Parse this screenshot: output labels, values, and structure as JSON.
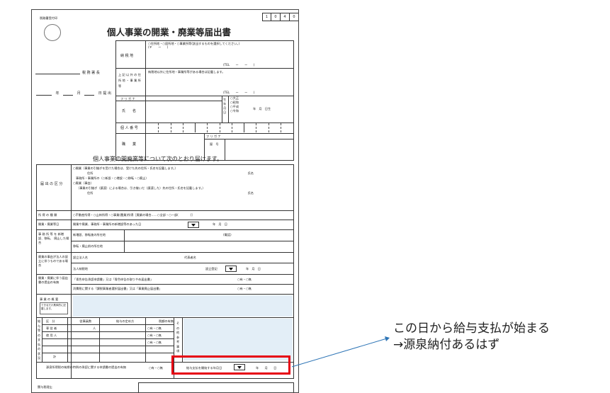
{
  "form": {
    "receipt_stamp_label": "税務署受付印",
    "form_code": [
      "1",
      "0",
      "4",
      "0"
    ],
    "title": "個人事業の開業・廃業等届出書",
    "tax_office_suffix": "税 務 署 長",
    "date_line": {
      "year": "年",
      "month": "月",
      "day": "日 提 出"
    },
    "address_label": "納 税 地",
    "address_options": "○住所地・○居所地・○事業所等(該当するものを選択してください。)",
    "postal_prefix": "(〒　　ー　　)",
    "tel": "(TEL　　ー　　ー　　)",
    "other_address_label": "上 記 以 外 の 住 所 地 ・ 事 業 所 等",
    "other_address_note": "納税地以外に住所地・事業所等がある場合は記載します。",
    "furigana": "フ リ ガ ナ",
    "name_label": "氏　　名",
    "birth_label": "生 年 月 日",
    "era_options": [
      "○大正",
      "○昭和",
      "○平成",
      "○令和"
    ],
    "birth_ymd": "年　月　日生",
    "my_number_label": "個 人 番 号",
    "occupation_label": "職　　業",
    "trade_name_label": "屋　号",
    "trade_furigana": "フ リ ガ ナ",
    "subtitle": "個人事業の開廃業等について次のとおり届けます。",
    "category_label": "届 出 の 区 分",
    "category_lines": [
      "○開業（事業の引継ぎを受けた場合は、受けた先の住所・氏名を記載します。）",
      "住所",
      "氏名",
      "事務所・事業所の（○新設・○増設・○移転・○廃止）",
      "○廃業（事由）",
      "（事業の引継ぎ（譲渡）による場合は、引き継いだ（譲渡した）先の住所・氏名を記載します。）",
      "住所",
      "氏名"
    ],
    "income_type_label": "所 得 の 種 類",
    "income_type_value": "○不動産所得・○山林所得・○事業(農業)所得［廃業の場合……○全部・○一部(　　　　)］",
    "start_date_label": "開業・廃業等日",
    "start_date_value": "開業や廃業、事務所・事業所の新増設等のあった日",
    "start_date_ymd": "年　月　日",
    "office_change_label": "事 務 所 等 を 新増設、移転、 廃止した場合",
    "new_location_label": "新増設、移転後の所在地",
    "phone_label": "(電話)",
    "old_location_label": "移転・廃止前の所在地",
    "corp_label": "廃業の事由が法人の設立に伴うものである場合",
    "corp_name_label": "設立法人名",
    "rep_label": "代表者名",
    "corp_taxplace_label": "法人納税地",
    "reg_label": "設立登記",
    "reg_ymd": "年　月　日",
    "filing_label": "開業・廃業に伴う届出書の提出の有無",
    "filing_row1": "「青色申告承認申請書」又は「青色申告の取りやめ届出書」",
    "filing_row2": "消費税に関する「課税事業者選択届出書」又は「事業廃止届出書」",
    "yes_no": "○有・○無",
    "business_summary_label": "事 業 の 概 要",
    "business_summary_note": "できるだけ具体的に記載します。",
    "salary_side_label": "給 与 等 の 支 払 の 状 況",
    "salary_headers": [
      "区　分",
      "従事員数",
      "給与の定め方",
      "税額の有無"
    ],
    "salary_rows": [
      {
        "label": "専 従 者",
        "count": "人"
      },
      {
        "label": "使 用 人",
        "count": ""
      },
      {
        "label": "",
        "count": ""
      },
      {
        "label": "計",
        "count": ""
      }
    ],
    "other_notes_label": "そ の 他 参 考 事 項",
    "special_label": "源泉所得税の納期の特例の承認に関する申請書の提出の有無",
    "salary_start_label": "給与支払を開始する年月日",
    "salary_start_ymd": "年　　月　　日",
    "bottom_label": "関与税理士"
  },
  "annotation": {
    "line1": "この日から給与支払が始まる",
    "line2": "→源泉納付あるはず",
    "highlight_color": "#e60012",
    "arrow_color": "#2e75b6"
  }
}
